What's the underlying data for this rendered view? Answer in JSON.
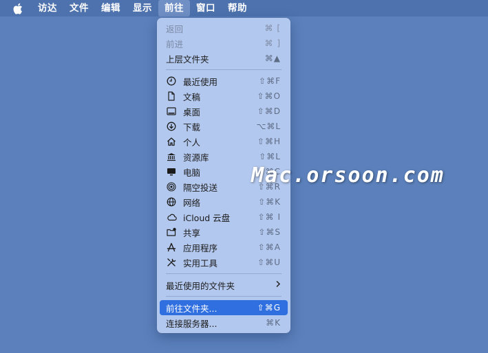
{
  "menubar": {
    "apple_icon": "apple-logo-icon",
    "items": [
      "访达",
      "文件",
      "编辑",
      "显示",
      "前往",
      "窗口",
      "帮助"
    ],
    "active_index": 4
  },
  "menu": {
    "top": [
      {
        "label": "返回",
        "shortcut": "⌘ [",
        "enabled": false
      },
      {
        "label": "前进",
        "shortcut": "⌘ ]",
        "enabled": false
      },
      {
        "label": "上层文件夹",
        "shortcut": "⌘▲",
        "enabled": true
      }
    ],
    "places": [
      {
        "label": "最近使用",
        "shortcut": "⇧⌘F",
        "icon": "clock-icon"
      },
      {
        "label": "文稿",
        "shortcut": "⇧⌘O",
        "icon": "document-icon"
      },
      {
        "label": "桌面",
        "shortcut": "⇧⌘D",
        "icon": "desktop-icon"
      },
      {
        "label": "下载",
        "shortcut": "⌥⌘L",
        "icon": "download-icon"
      },
      {
        "label": "个人",
        "shortcut": "⇧⌘H",
        "icon": "home-icon"
      },
      {
        "label": "资源库",
        "shortcut": "⇧⌘L",
        "icon": "library-icon"
      },
      {
        "label": "电脑",
        "shortcut": "⇧⌘C",
        "icon": "computer-icon"
      },
      {
        "label": "隔空投送",
        "shortcut": "⇧⌘R",
        "icon": "airdrop-icon"
      },
      {
        "label": "网络",
        "shortcut": "⇧⌘K",
        "icon": "network-icon"
      },
      {
        "label": "iCloud 云盘",
        "shortcut": "⇧⌘ I",
        "icon": "cloud-icon"
      },
      {
        "label": "共享",
        "shortcut": "⇧⌘S",
        "icon": "shared-folder-icon"
      },
      {
        "label": "应用程序",
        "shortcut": "⇧⌘A",
        "icon": "applications-icon"
      },
      {
        "label": "实用工具",
        "shortcut": "⇧⌘U",
        "icon": "utilities-icon"
      }
    ],
    "recent_folders": {
      "label": "最近使用的文件夹",
      "submenu_icon": "chevron-right-icon"
    },
    "bottom": [
      {
        "label": "前往文件夹...",
        "shortcut": "⇧⌘G",
        "selected": true
      },
      {
        "label": "连接服务器...",
        "shortcut": "⌘K",
        "selected": false
      }
    ]
  },
  "watermark": "Mac.orsoon.com",
  "colors": {
    "desktop": "#5b80bb",
    "menubar": "#4d72ad",
    "menu_bg": "#b3c8ee",
    "selection": "#2f6fe0"
  }
}
